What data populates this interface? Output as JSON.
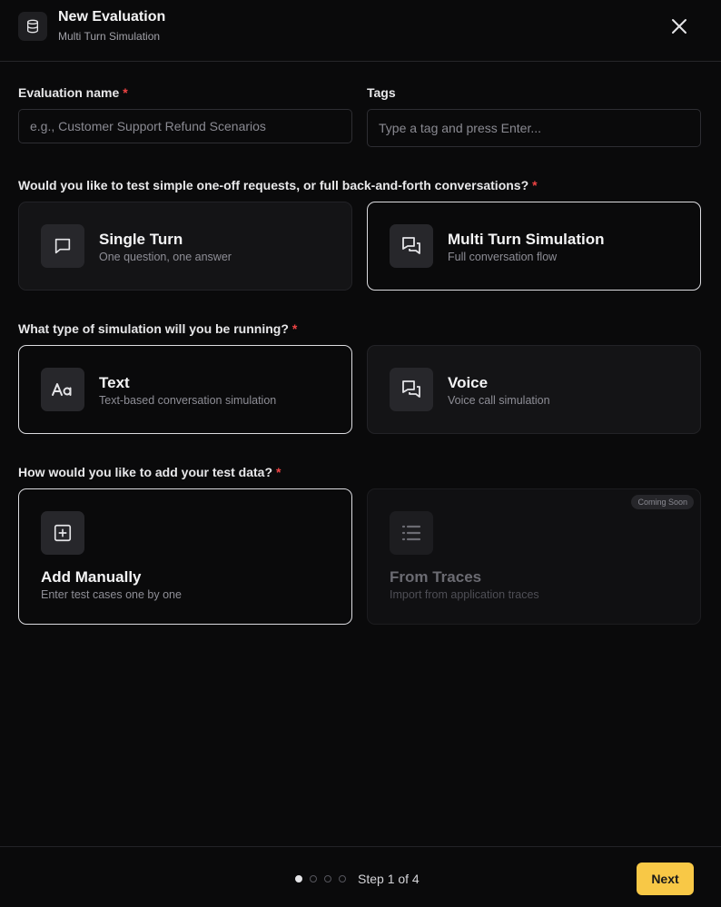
{
  "header": {
    "title": "New Evaluation",
    "subtitle": "Multi Turn Simulation"
  },
  "fields": {
    "name_label": "Evaluation name",
    "required_mark": "*",
    "name_placeholder": "e.g., Customer Support Refund Scenarios",
    "name_value": "",
    "tags_label": "Tags",
    "tags_placeholder": "Type a tag and press Enter..."
  },
  "questions": {
    "turn": "Would you like to test simple one-off requests, or full back-and-forth conversations?",
    "simulation": "What type of simulation will you be running?",
    "data": "How would you like to add your test data?"
  },
  "turn_options": [
    {
      "title": "Single Turn",
      "desc": "One question, one answer",
      "icon": "chat-bubble-icon",
      "selected": false
    },
    {
      "title": "Multi Turn Simulation",
      "desc": "Full conversation flow",
      "icon": "conversation-icon",
      "selected": true
    }
  ],
  "sim_options": [
    {
      "title": "Text",
      "desc": "Text-based conversation simulation",
      "icon": "text-aa-icon",
      "selected": true
    },
    {
      "title": "Voice",
      "desc": "Voice call simulation",
      "icon": "conversation-icon",
      "selected": false
    }
  ],
  "data_options": [
    {
      "title": "Add Manually",
      "desc": "Enter test cases one by one",
      "icon": "plus-square-icon",
      "selected": true
    },
    {
      "title": "From Traces",
      "desc": "Import from application traces",
      "icon": "list-icon",
      "selected": false,
      "disabled": true,
      "badge": "Coming Soon"
    }
  ],
  "footer": {
    "step_text": "Step 1 of 4",
    "current_step": 1,
    "total_steps": 4,
    "next_label": "Next"
  },
  "colors": {
    "background": "#0a0a0b",
    "accent": "#f8c846",
    "required": "#ef4444"
  }
}
